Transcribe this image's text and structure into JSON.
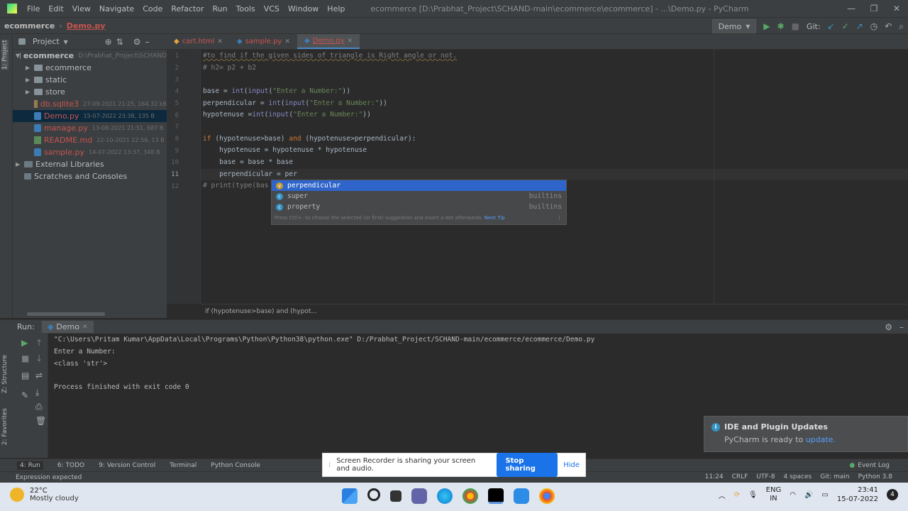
{
  "window": {
    "menu": [
      "File",
      "Edit",
      "View",
      "Navigate",
      "Code",
      "Refactor",
      "Run",
      "Tools",
      "VCS",
      "Window",
      "Help"
    ],
    "title": "ecommerce [D:\\Prabhat_Project\\SCHAND-main\\ecommerce\\ecommerce] - ...\\Demo.py - PyCharm",
    "controls": [
      "—",
      "❐",
      "✕"
    ]
  },
  "navbar": {
    "project": "ecommerce",
    "file": "Demo.py",
    "run_config": "Demo",
    "git_label": "Git:"
  },
  "project_panel": {
    "header": "Project",
    "root": {
      "name": "ecommerce",
      "path": "D:\\Prabhat_Project\\SCHAND"
    },
    "items": [
      {
        "name": "ecommerce",
        "type": "folder",
        "meta": ""
      },
      {
        "name": "static",
        "type": "folder",
        "meta": ""
      },
      {
        "name": "store",
        "type": "folder",
        "meta": ""
      },
      {
        "name": "db.sqlite3",
        "type": "db",
        "meta": "27-09-2021 21:25, 164.32 kB"
      },
      {
        "name": "Demo.py",
        "type": "py",
        "meta": "15-07-2022 23:38, 135 B"
      },
      {
        "name": "manage.py",
        "type": "py",
        "meta": "13-08-2021 21:51, 687 B"
      },
      {
        "name": "README.md",
        "type": "md",
        "meta": "22-10-2021 22:56, 13 B"
      },
      {
        "name": "sample.py",
        "type": "py",
        "meta": "14-07-2022 13:37, 348 B"
      }
    ],
    "external": "External Libraries",
    "scratches": "Scratches and Consoles"
  },
  "left_vtabs": {
    "project": "1: Project",
    "structure": "Z: Structure",
    "favorites": "2: Favorites"
  },
  "tabs": [
    {
      "label": "cart.html",
      "active": false
    },
    {
      "label": "sample.py",
      "active": false
    },
    {
      "label": "Demo.py",
      "active": true
    }
  ],
  "editor": {
    "line_numbers": [
      "1",
      "2",
      "3",
      "4",
      "5",
      "6",
      "7",
      "8",
      "9",
      "10",
      "11",
      "12"
    ],
    "lines": {
      "l1": "#to find if the given sides of triangle is Right angle or not.",
      "l2": "# h2= p2 + b2",
      "l4a": "base = ",
      "l4b": "int",
      "l4c": "(",
      "l4d": "input",
      "l4e": "(",
      "l4f": "\"Enter a Number:\"",
      "l4g": "))",
      "l5a": "perpendicular = ",
      "l5b": "int",
      "l5c": "(",
      "l5d": "input",
      "l5e": "(",
      "l5f": "\"Enter a Number:\"",
      "l5g": "))",
      "l6a": "hypotenuse =",
      "l6b": "int",
      "l6c": "(",
      "l6d": "input",
      "l6e": "(",
      "l6f": "\"Enter a Number:\"",
      "l6g": "))",
      "l8a": "if",
      "l8b": " (hypotenuse>base) ",
      "l8c": "and",
      "l8d": " (hypotenuse>perpendicular):",
      "l9": "    hypotenuse = hypotenuse * hypotenuse",
      "l10": "    base = base * base",
      "l11": "    perpendicular = per",
      "l12": "# print(type(bas"
    },
    "breadcrumb": "if (hypotenuse>base) and (hypot..."
  },
  "autocomplete": {
    "items": [
      {
        "label": "perpendicular",
        "source": "",
        "icon": "v",
        "color": "#c49a3a"
      },
      {
        "label": "super",
        "source": "builtins",
        "icon": "c",
        "color": "#3592c4"
      },
      {
        "label": "property",
        "source": "builtins",
        "icon": "c",
        "color": "#3592c4"
      }
    ],
    "hint": "Press Ctrl+. to choose the selected (or first) suggestion and insert a dot afterwards",
    "hint_link": "Next Tip"
  },
  "run_panel": {
    "label": "Run:",
    "tab": "Demo",
    "console": [
      "\"C:\\Users\\Pritam Kumar\\AppData\\Local\\Programs\\Python\\Python38\\python.exe\" D:/Prabhat_Project/SCHAND-main/ecommerce/ecommerce/Demo.py",
      "Enter a Number:",
      "<class 'str'>",
      "",
      "Process finished with exit code 0"
    ]
  },
  "notification": {
    "title": "IDE and Plugin Updates",
    "body": "PyCharm is ready to ",
    "link": "update."
  },
  "share_bar": {
    "text": "Screen Recorder is sharing your screen and audio.",
    "stop": "Stop sharing",
    "hide": "Hide"
  },
  "toolwindows": [
    "4: Run",
    "6: TODO",
    "9: Version Control",
    "Terminal",
    "Python Console"
  ],
  "event_log": "Event Log",
  "status": {
    "message": "Expression expected",
    "position": "11:24",
    "line_sep": "CRLF",
    "encoding": "UTF-8",
    "indent": "4 spaces",
    "git": "Git: main",
    "interpreter": "Python 3.8"
  },
  "taskbar": {
    "temp": "22°C",
    "weather": "Mostly cloudy",
    "lang1": "ENG",
    "lang2": "IN",
    "time": "23:41",
    "date": "15-07-2022"
  }
}
